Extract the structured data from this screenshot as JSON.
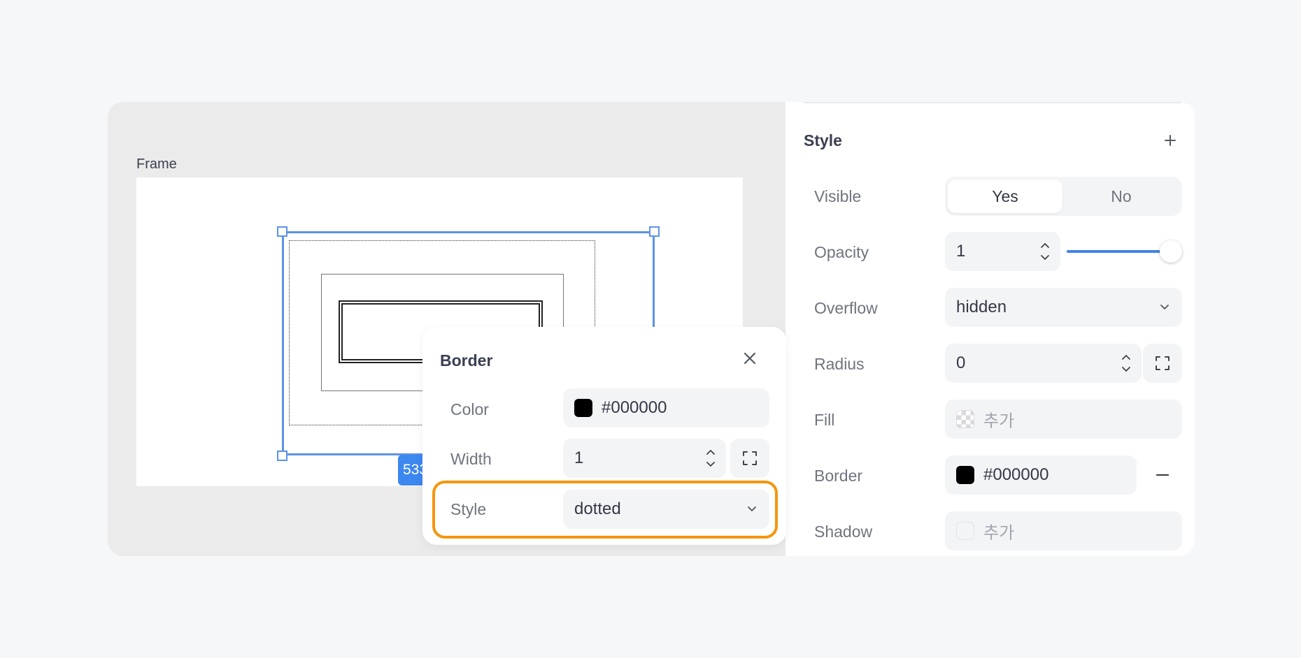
{
  "canvas": {
    "frame_label": "Frame",
    "size_badge": "533"
  },
  "border_popover": {
    "title": "Border",
    "color_label": "Color",
    "color_value": "#000000",
    "width_label": "Width",
    "width_value": "1",
    "style_label": "Style",
    "style_value": "dotted"
  },
  "style_panel": {
    "title": "Style",
    "visible": {
      "label": "Visible",
      "yes": "Yes",
      "no": "No"
    },
    "opacity": {
      "label": "Opacity",
      "value": "1",
      "level": 1
    },
    "overflow": {
      "label": "Overflow",
      "value": "hidden"
    },
    "radius": {
      "label": "Radius",
      "value": "0"
    },
    "fill": {
      "label": "Fill",
      "placeholder": "추가"
    },
    "border": {
      "label": "Border",
      "value": "#000000"
    },
    "shadow": {
      "label": "Shadow",
      "placeholder": "추가"
    }
  },
  "colors": {
    "accent": "#3f83e8",
    "highlight": "#f5960d",
    "selection": "#5c93e6"
  }
}
